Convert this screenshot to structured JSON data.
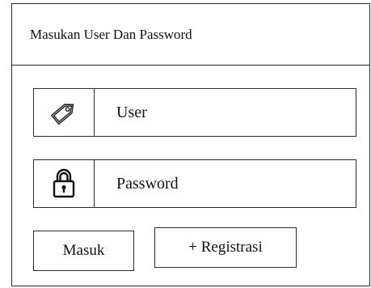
{
  "panel": {
    "title": "Masukan User Dan Password"
  },
  "fields": {
    "user": {
      "icon": "tag-icon",
      "label": "User"
    },
    "password": {
      "icon": "lock-icon",
      "label": "Password"
    }
  },
  "buttons": {
    "login_label": "Masuk",
    "register_label": "+ Registrasi"
  }
}
